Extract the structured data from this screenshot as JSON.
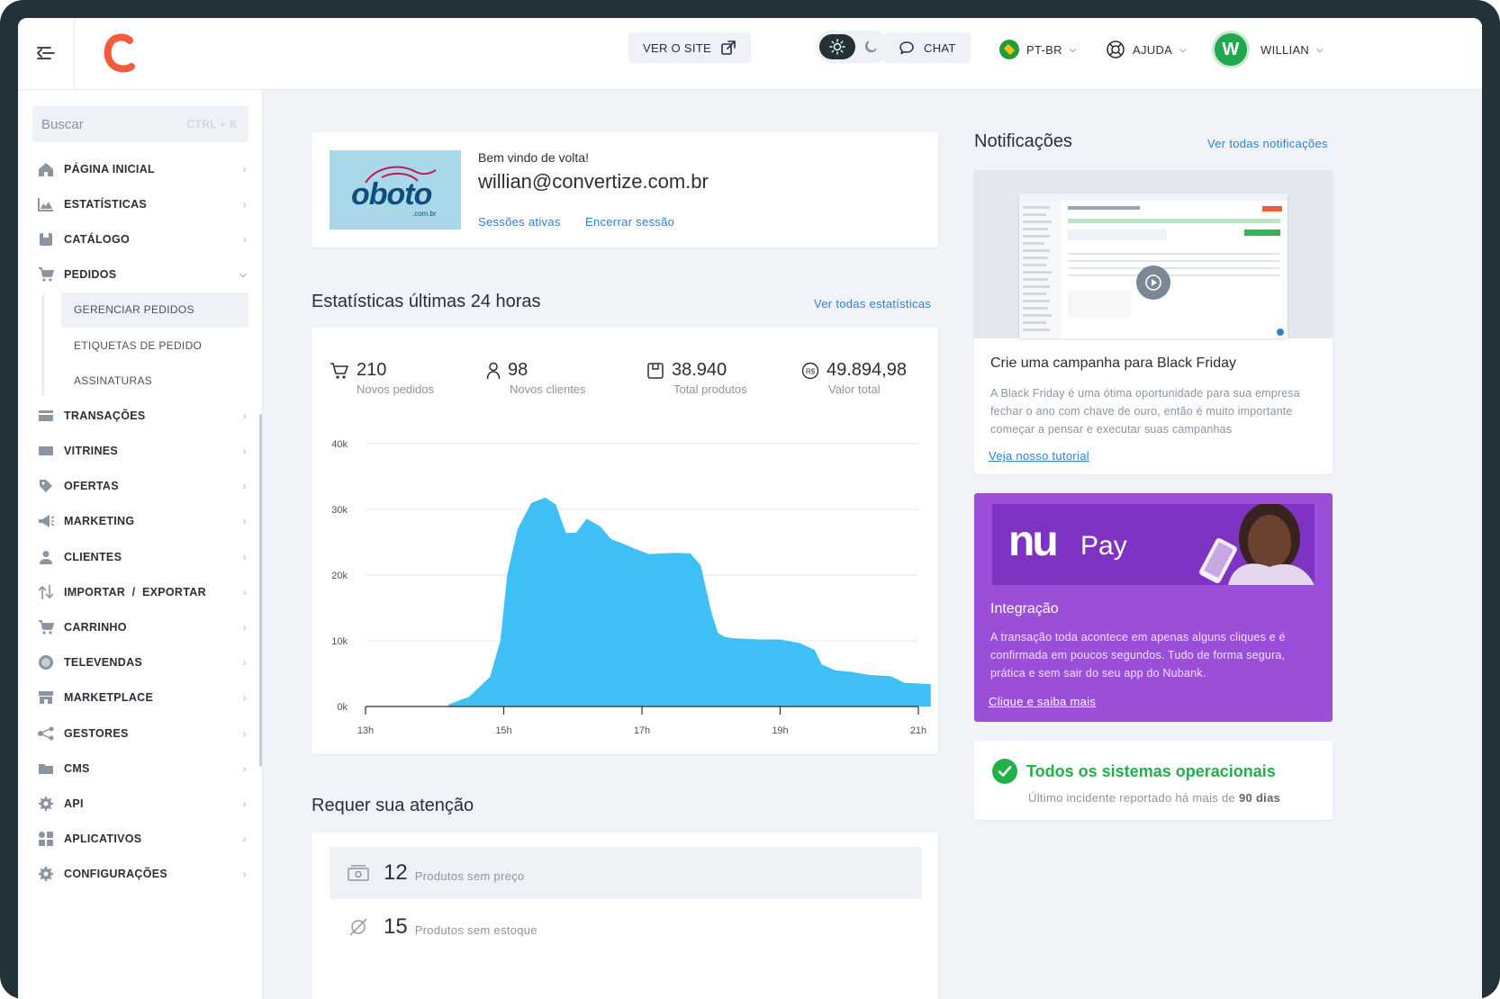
{
  "topbar": {
    "ver_site": "VER O SITE",
    "chat": "CHAT",
    "language": "PT-BR",
    "ajuda": "AJUDA",
    "avatar_initial": "W",
    "user": "WILLIAN"
  },
  "sidebar": {
    "search_placeholder": "Buscar",
    "search_shortcut": "CTRL + K",
    "items": [
      {
        "label": "PÁGINA INICIAL",
        "icon": "home-icon"
      },
      {
        "label": "ESTATÍSTICAS",
        "icon": "chart-icon"
      },
      {
        "label": "CATÁLOGO",
        "icon": "catalog-icon"
      },
      {
        "label": "PEDIDOS",
        "icon": "cart-icon"
      },
      {
        "label": "TRANSAÇÕES",
        "icon": "transactions-icon"
      },
      {
        "label": "VITRINES",
        "icon": "showcase-icon"
      },
      {
        "label": "OFERTAS",
        "icon": "tag-icon"
      },
      {
        "label": "MARKETING",
        "icon": "megaphone-icon"
      },
      {
        "label": "CLIENTES",
        "icon": "user-icon"
      },
      {
        "label": "IMPORTAR  /  EXPORTAR",
        "icon": "import-export-icon"
      },
      {
        "label": "CARRINHO",
        "icon": "cart-icon"
      },
      {
        "label": "TELEVENDAS",
        "icon": "headset-icon"
      },
      {
        "label": "MARKETPLACE",
        "icon": "store-icon"
      },
      {
        "label": "GESTORES",
        "icon": "share-icon"
      },
      {
        "label": "CMS",
        "icon": "folder-icon"
      },
      {
        "label": "API",
        "icon": "gear-code-icon"
      },
      {
        "label": "APLICATIVOS",
        "icon": "apps-icon"
      },
      {
        "label": "CONFIGURAÇÕES",
        "icon": "gear-icon"
      }
    ],
    "pedidos_sub": [
      "GERENCIAR PEDIDOS",
      "ETIQUETAS DE PEDIDO",
      "ASSINATURAS"
    ]
  },
  "welcome": {
    "brand_logo_text": "oboto",
    "brand_logo_sub": ".com.br",
    "greeting": "Bem vindo de volta!",
    "email": "willian@convertize.com.br",
    "sessions_link": "Sessões ativas",
    "logout_link": "Encerrar sessão"
  },
  "stats": {
    "title": "Estatísticas últimas 24 horas",
    "all_link": "Ver todas estatísticas",
    "items": [
      {
        "value": "210",
        "caption": "Novos pedidos",
        "icon": "cart-icon"
      },
      {
        "value": "98",
        "caption": "Novos clientes",
        "icon": "user-icon"
      },
      {
        "value": "38.940",
        "caption": "Total produtos",
        "icon": "box-icon"
      },
      {
        "value": "49.894,98",
        "caption": "Valor total",
        "icon": "currency-icon"
      }
    ]
  },
  "chart_data": {
    "type": "area",
    "x": [
      14.2,
      14.5,
      14.8,
      14.95,
      15.05,
      15.2,
      15.4,
      15.6,
      15.75,
      15.9,
      16.05,
      16.2,
      16.4,
      16.55,
      16.7,
      16.9,
      17.1,
      17.3,
      17.5,
      17.7,
      17.85,
      18.0,
      18.1,
      18.2,
      18.3,
      18.5,
      18.7,
      19.0,
      19.3,
      19.5,
      19.6,
      19.8,
      20.0,
      20.3,
      20.6,
      20.8,
      21.0,
      21.18
    ],
    "y": [
      300,
      1500,
      4500,
      10000,
      20000,
      27000,
      31000,
      31800,
      30800,
      26400,
      26500,
      28600,
      27400,
      25500,
      24900,
      24000,
      23200,
      23300,
      23400,
      23300,
      21500,
      14500,
      11200,
      10600,
      10400,
      10300,
      10200,
      10200,
      9600,
      8600,
      6400,
      5500,
      5300,
      4800,
      4600,
      3600,
      3500,
      3400
    ],
    "xticks": [
      "13h",
      "15h",
      "17h",
      "19h",
      "21h"
    ],
    "yticks": [
      "0k",
      "10k",
      "20k",
      "30k",
      "40k"
    ],
    "xlim": [
      13,
      21
    ],
    "ylim": [
      0,
      40000
    ],
    "grid": true,
    "color": "#3ec0f7"
  },
  "attention": {
    "title": "Requer sua atenção",
    "items": [
      {
        "value": "12",
        "label": "Produtos sem preço",
        "icon": "money-icon"
      },
      {
        "value": "15",
        "label": "Produtos sem estoque",
        "icon": "empty-set-icon"
      }
    ]
  },
  "notifications": {
    "title": "Notificações",
    "all_link": "Ver todas notificações",
    "campaign": {
      "title": "Crie uma campanha para Black Friday",
      "text": "A Black Friday é uma ótima oportunidade para sua empresa fechar o ano com chave de ouro, então é muito importante começar a pensar e executar suas campanhas",
      "link": "Veja nosso tutorial"
    },
    "nubank": {
      "brand": "nu",
      "brand_pay": "Pay",
      "title": "Integração",
      "text": "A transação toda acontece em apenas alguns cliques e é confirmada em poucos segundos. Tudo de forma segura, prática e sem sair do seu app do Nubank.",
      "link": "Clique e saiba mais"
    },
    "status": {
      "title": "Todos os sistemas operacionais",
      "text_prefix": "Último incidente reportado há mais de ",
      "text_strong": "90 dias"
    }
  },
  "colors": {
    "accent_link": "#2f7fd1",
    "chart_fill": "#3ec0f7",
    "status_green": "#22b04b",
    "nubank_purple": "#9b4fd8",
    "logo_red": "#f15a3a"
  }
}
